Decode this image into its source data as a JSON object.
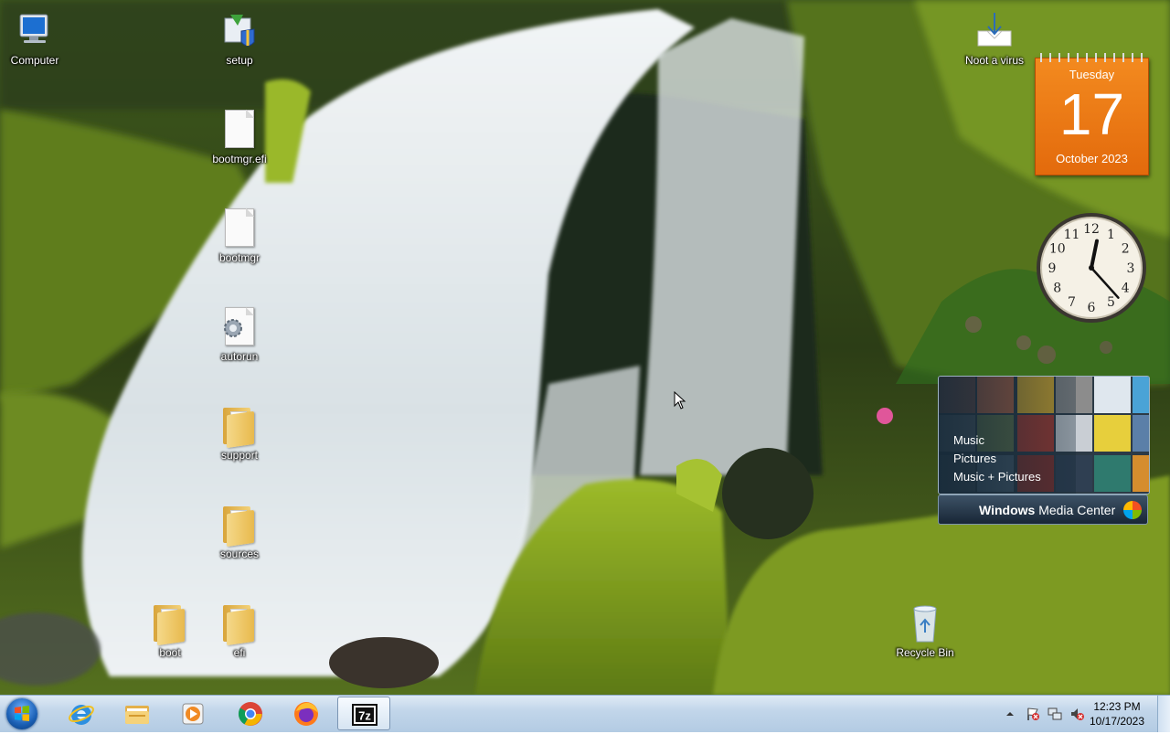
{
  "desktop": {
    "icons": [
      {
        "label": "Computer",
        "icon": "computer-icon"
      },
      {
        "label": "setup",
        "icon": "setup-icon"
      },
      {
        "label": "bootmgr.efi",
        "icon": "file-icon"
      },
      {
        "label": "bootmgr",
        "icon": "file-icon"
      },
      {
        "label": "autorun",
        "icon": "settings-file-icon"
      },
      {
        "label": "support",
        "icon": "folder-icon"
      },
      {
        "label": "sources",
        "icon": "folder-icon"
      },
      {
        "label": "boot",
        "icon": "folder-icon"
      },
      {
        "label": "efi",
        "icon": "folder-icon"
      },
      {
        "label": "Noot a virus",
        "icon": "installer-box-icon"
      },
      {
        "label": "Recycle Bin",
        "icon": "recycle-bin-icon"
      }
    ]
  },
  "gadgets": {
    "calendar": {
      "weekday": "Tuesday",
      "day": "17",
      "month_year": "October 2023",
      "color": "#e9760f"
    },
    "clock": {
      "hour": 12,
      "minute": 23,
      "numerals": [
        "12",
        "1",
        "2",
        "3",
        "4",
        "5",
        "6",
        "7",
        "8",
        "9",
        "10",
        "11"
      ]
    },
    "media_center": {
      "menu": [
        "Music",
        "Pictures",
        "Music + Pictures"
      ],
      "brand_bold": "Windows",
      "brand_rest": " Media Center"
    }
  },
  "taskbar": {
    "pinned": [
      {
        "name": "start-button",
        "icon": "windows-orb-icon"
      },
      {
        "name": "internet-explorer",
        "icon": "internet-explorer-icon"
      },
      {
        "name": "windows-explorer",
        "icon": "folder-icon"
      },
      {
        "name": "windows-media-player",
        "icon": "media-player-icon"
      },
      {
        "name": "google-chrome",
        "icon": "chrome-icon"
      },
      {
        "name": "firefox",
        "icon": "firefox-icon"
      },
      {
        "name": "7-zip",
        "icon": "7zip-icon",
        "label": "7z",
        "active": true
      }
    ],
    "tray": {
      "icons": [
        "show-hidden-icons-arrow",
        "action-center-flag-icon",
        "network-icon",
        "volume-muted-icon"
      ],
      "time": "12:23 PM",
      "date": "10/17/2023"
    }
  },
  "colors": {
    "taskbar": "#c2d6ea",
    "calendar": "#e9760f",
    "wmc_panel": "#2c3a46"
  }
}
